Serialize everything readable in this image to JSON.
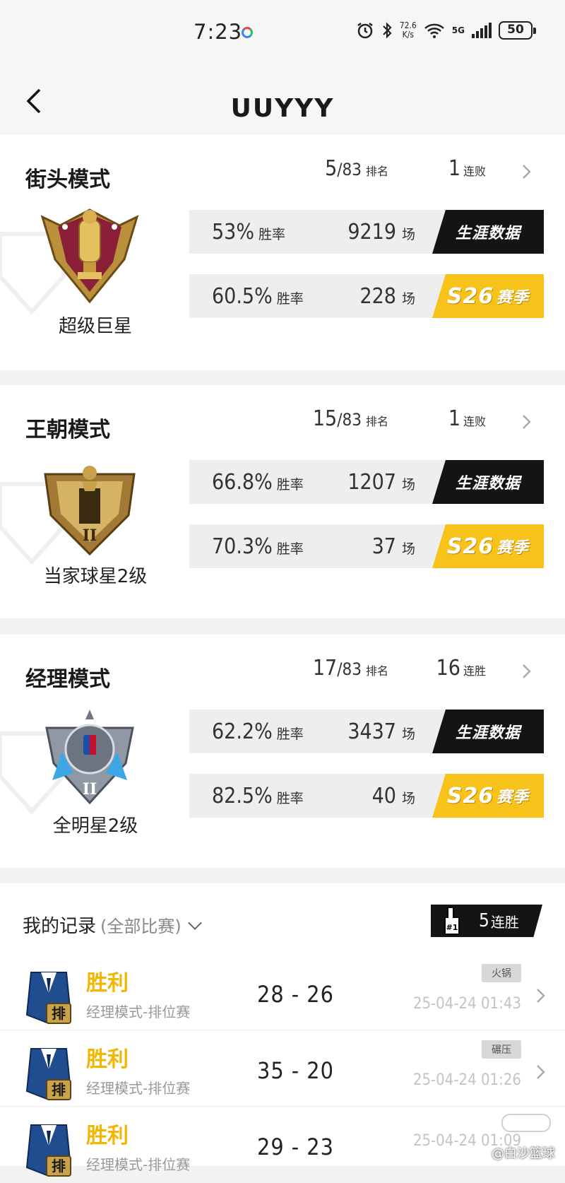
{
  "status_bar": {
    "time": "7:23",
    "speed_value": "72.6",
    "speed_unit": "K/s",
    "network": "5G",
    "battery": "50"
  },
  "nav": {
    "title": "UUYYY"
  },
  "modes": [
    {
      "name": "街头模式",
      "rank": "5",
      "rank_total": "/83",
      "rank_label": "排名",
      "streak": "1",
      "streak_label": "连败",
      "badge_name": "超级巨星",
      "career": {
        "win_rate": "53%",
        "win_rate_label": "胜率",
        "games": "9219",
        "games_label": "场",
        "tag": "生涯数据"
      },
      "season": {
        "win_rate": "60.5%",
        "win_rate_label": "胜率",
        "games": "228",
        "games_label": "场",
        "tag_prefix": "S26",
        "tag": "赛季"
      }
    },
    {
      "name": "王朝模式",
      "rank": "15",
      "rank_total": "/83",
      "rank_label": "排名",
      "streak": "1",
      "streak_label": "连败",
      "badge_name": "当家球星2级",
      "career": {
        "win_rate": "66.8%",
        "win_rate_label": "胜率",
        "games": "1207",
        "games_label": "场",
        "tag": "生涯数据"
      },
      "season": {
        "win_rate": "70.3%",
        "win_rate_label": "胜率",
        "games": "37",
        "games_label": "场",
        "tag_prefix": "S26",
        "tag": "赛季"
      }
    },
    {
      "name": "经理模式",
      "rank": "17",
      "rank_total": "/83",
      "rank_label": "排名",
      "streak": "16",
      "streak_label": "连胜",
      "badge_name": "全明星2级",
      "career": {
        "win_rate": "62.2%",
        "win_rate_label": "胜率",
        "games": "3437",
        "games_label": "场",
        "tag": "生涯数据"
      },
      "season": {
        "win_rate": "82.5%",
        "win_rate_label": "胜率",
        "games": "40",
        "games_label": "场",
        "tag_prefix": "S26",
        "tag": "赛季"
      }
    }
  ],
  "records": {
    "title": "我的记录",
    "filter": "(全部比赛)",
    "streak_badge": {
      "count": "5",
      "label": "连胜",
      "rank_mark": "#1"
    },
    "matches": [
      {
        "result": "胜利",
        "mode": "经理模式-排位赛",
        "score": "28 - 26",
        "label": "火锅",
        "date": "25-04-24 01:43",
        "badge_char": "排"
      },
      {
        "result": "胜利",
        "mode": "经理模式-排位赛",
        "score": "35 - 20",
        "label": "碾压",
        "date": "25-04-24 01:26",
        "badge_char": "排"
      },
      {
        "result": "胜利",
        "mode": "经理模式-排位赛",
        "score": "29 - 23",
        "label": "",
        "date": "25-04-24 01:09",
        "badge_char": "排"
      }
    ]
  },
  "watermark": "@白沙篮球",
  "colors": {
    "win": "#f2b705",
    "season_tag": "#f7c21a",
    "career_tag": "#141414",
    "row_bg": "#eeeeee"
  }
}
